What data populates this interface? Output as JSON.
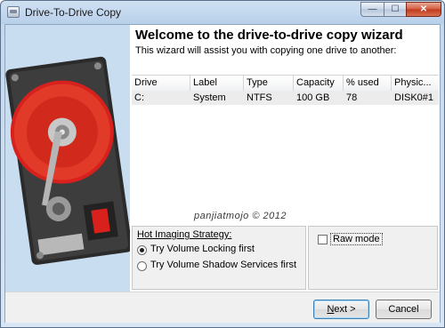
{
  "window": {
    "title": "Drive-To-Drive Copy",
    "controls": {
      "minimize": "—",
      "maximize": "☐",
      "close": "✕"
    }
  },
  "wizard": {
    "heading": "Welcome to the drive-to-drive copy wizard",
    "description": "This wizard will assist you with copying one drive to another:"
  },
  "table": {
    "columns": [
      "Drive",
      "Label",
      "Type",
      "Capacity",
      "% used",
      "Physic..."
    ],
    "rows": [
      [
        "C:",
        "System",
        "NTFS",
        "100 GB",
        "78",
        "DISK0#1"
      ]
    ]
  },
  "watermark": "panjiatmojo © 2012",
  "hot_imaging": {
    "title": "Hot Imaging Strategy:",
    "options": [
      {
        "label": "Try Volume Locking first",
        "selected": true
      },
      {
        "label": "Try Volume Shadow Services first",
        "selected": false
      }
    ]
  },
  "raw_mode": {
    "label": "Raw mode",
    "checked": false
  },
  "buttons": {
    "next": "Next >",
    "cancel": "Cancel"
  },
  "colors": {
    "disk_platter": "#d8201c",
    "sidebar_bg": "#c9ddf1",
    "default_button": "#3c7fb1"
  }
}
